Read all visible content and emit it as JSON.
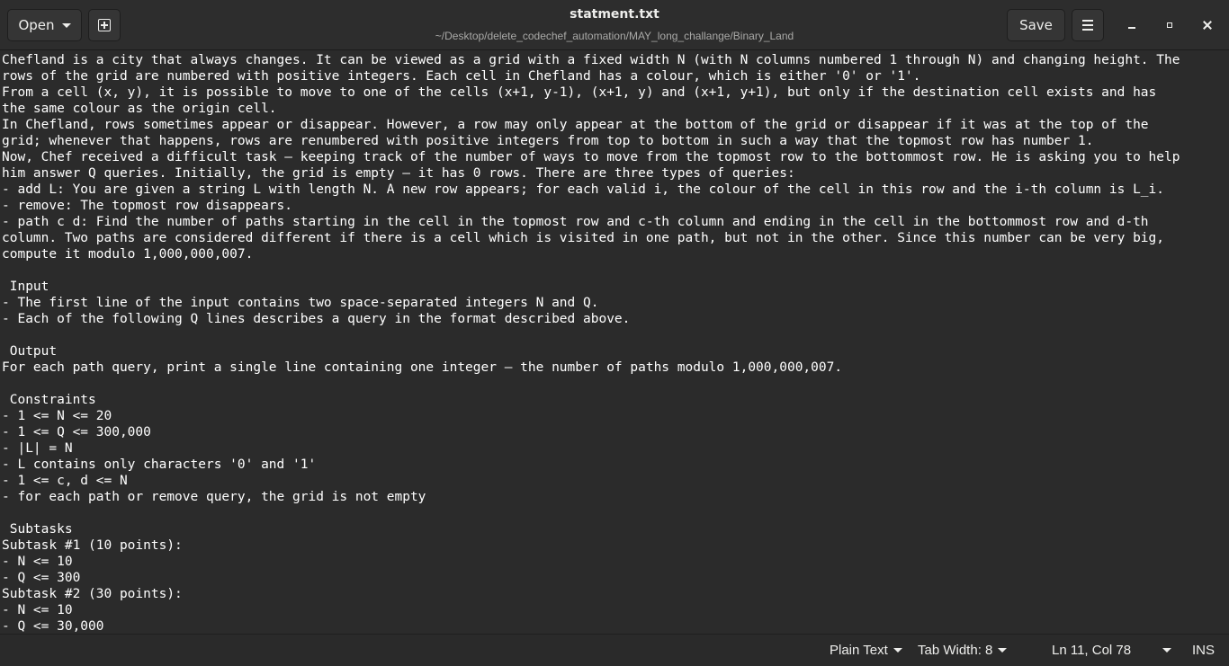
{
  "header": {
    "open_label": "Open",
    "title": "statment.txt",
    "path": "~/Desktop/delete_codechef_automation/MAY_long_challange/Binary_Land",
    "save_label": "Save"
  },
  "editor": {
    "lines": [
      "Chefland is a city that always changes. It can be viewed as a grid with a fixed width N (with N columns numbered 1 through N) and changing height. The",
      "rows of the grid are numbered with positive integers. Each cell in Chefland has a colour, which is either '0' or '1'.",
      "From a cell (x, y), it is possible to move to one of the cells (x+1, y-1), (x+1, y) and (x+1, y+1), but only if the destination cell exists and has",
      "the same colour as the origin cell.",
      "In Chefland, rows sometimes appear or disappear. However, a row may only appear at the bottom of the grid or disappear if it was at the top of the",
      "grid; whenever that happens, rows are renumbered with positive integers from top to bottom in such a way that the topmost row has number 1.",
      "Now, Chef received a difficult task — keeping track of the number of ways to move from the topmost row to the bottommost row. He is asking you to help",
      "him answer Q queries. Initially, the grid is empty — it has 0 rows. There are three types of queries:",
      "- add L: You are given a string L with length N. A new row appears; for each valid i, the colour of the cell in this row and the i-th column is L_i.",
      "- remove: The topmost row disappears.",
      "- path c d: Find the number of paths starting in the cell in the topmost row and c-th column and ending in the cell in the bottommost row and d-th",
      "column. Two paths are considered different if there is a cell which is visited in one path, but not in the other. Since this number can be very big,",
      "compute it modulo 1,000,000,007.",
      "",
      " Input",
      "- The first line of the input contains two space-separated integers N and Q.",
      "- Each of the following Q lines describes a query in the format described above.",
      "",
      " Output",
      "For each path query, print a single line containing one integer — the number of paths modulo 1,000,000,007.",
      "",
      " Constraints",
      "- 1 <= N <= 20",
      "- 1 <= Q <= 300,000",
      "- |L| = N",
      "- L contains only characters '0' and '1'",
      "- 1 <= c, d <= N",
      "- for each path or remove query, the grid is not empty",
      "",
      " Subtasks",
      "Subtask #1 (10 points):",
      "- N <= 10",
      "- Q <= 300",
      "Subtask #2 (30 points):",
      "- N <= 10",
      "- Q <= 30,000"
    ]
  },
  "statusbar": {
    "language": "Plain Text",
    "tab_width": "Tab Width: 8",
    "cursor_position": "Ln 11, Col 78",
    "insert_mode": "INS"
  }
}
